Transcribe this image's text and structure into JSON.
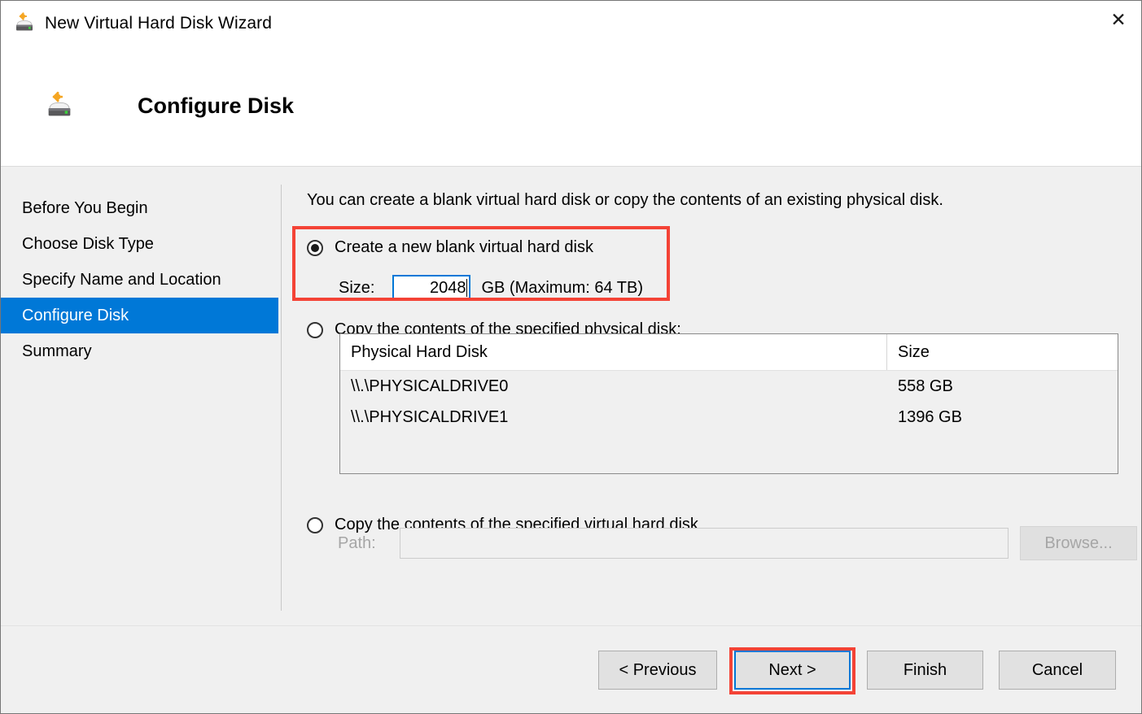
{
  "window": {
    "title": "New Virtual Hard Disk Wizard",
    "title_icon": "virtual-hard-disk-icon",
    "close_label": "✕"
  },
  "header": {
    "title": "Configure Disk",
    "icon": "virtual-hard-disk-icon"
  },
  "sidebar": {
    "items": [
      {
        "label": "Before You Begin",
        "selected": false
      },
      {
        "label": "Choose Disk Type",
        "selected": false
      },
      {
        "label": "Specify Name and Location",
        "selected": false
      },
      {
        "label": "Configure Disk",
        "selected": true
      },
      {
        "label": "Summary",
        "selected": false
      }
    ]
  },
  "content": {
    "intro": "You can create a blank virtual hard disk or copy the contents of an existing physical disk.",
    "option_blank": {
      "label": "Create a new blank virtual hard disk",
      "checked": true,
      "size_label": "Size:",
      "size_value": "2048",
      "size_suffix": "GB (Maximum: 64 TB)"
    },
    "option_physical": {
      "label": "Copy the contents of the specified physical disk:",
      "checked": false,
      "table": {
        "columns": [
          "Physical Hard Disk",
          "Size"
        ],
        "rows": [
          {
            "disk": "\\\\.\\PHYSICALDRIVE0",
            "size": "558 GB"
          },
          {
            "disk": "\\\\.\\PHYSICALDRIVE1",
            "size": "1396 GB"
          }
        ]
      }
    },
    "option_virtual": {
      "label": "Copy the contents of the specified virtual hard disk",
      "checked": false,
      "path_label": "Path:",
      "path_value": "",
      "path_placeholder": "",
      "browse_label": "Browse..."
    }
  },
  "footer": {
    "previous_label": "< Previous",
    "next_label": "Next >",
    "finish_label": "Finish",
    "cancel_label": "Cancel"
  },
  "colors": {
    "accent": "#0078d7",
    "annotation": "#f44336",
    "body_bg": "#f0f0f0",
    "disabled_text": "#a6a6a6"
  }
}
